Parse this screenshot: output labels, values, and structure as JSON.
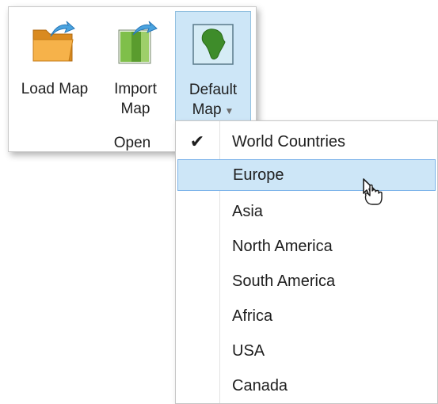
{
  "ribbon": {
    "buttons": {
      "load_map": {
        "label": "Load Map",
        "icon": "folder-open-icon"
      },
      "import_map": {
        "label_line1": "Import",
        "label_line2": "Map",
        "icon": "import-map-icon"
      },
      "default_map": {
        "label_line1": "Default",
        "label_line2": "Map",
        "icon": "africa-map-icon",
        "caret": "▼"
      }
    },
    "group_label": "Open"
  },
  "menu": {
    "items": [
      {
        "label": "World Countries",
        "checked": true,
        "check_glyph": "✔"
      },
      {
        "label": "Europe",
        "hovered": true
      },
      {
        "label": "Asia"
      },
      {
        "label": "North America"
      },
      {
        "label": "South America"
      },
      {
        "label": "Africa"
      },
      {
        "label": "USA"
      },
      {
        "label": "Canada"
      }
    ]
  },
  "colors": {
    "hover_fill": "#cde6f7",
    "hover_border": "#7eb4ea",
    "folder": "#f0a43a",
    "map_green": "#5a9c2e"
  }
}
